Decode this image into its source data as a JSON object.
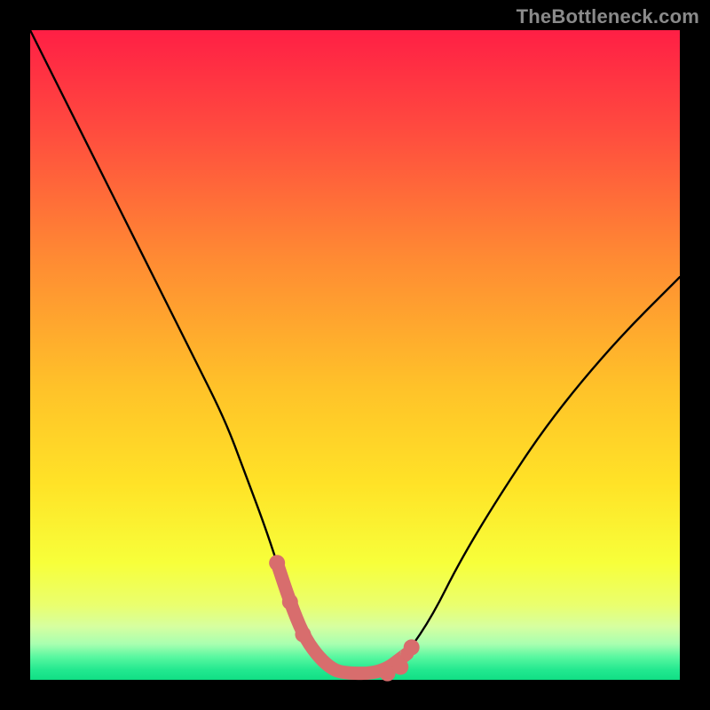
{
  "watermark": "TheBottleneck.com",
  "colors": {
    "frame": "#000000",
    "watermark": "#8a8a8a",
    "curve_stroke": "#000000",
    "highlight": "#d86d6d",
    "gradient_stops": [
      {
        "offset": 0.0,
        "color": "#ff1f45"
      },
      {
        "offset": 0.15,
        "color": "#ff4a3f"
      },
      {
        "offset": 0.35,
        "color": "#ff8a33"
      },
      {
        "offset": 0.55,
        "color": "#ffc229"
      },
      {
        "offset": 0.7,
        "color": "#ffe327"
      },
      {
        "offset": 0.82,
        "color": "#f7ff3a"
      },
      {
        "offset": 0.885,
        "color": "#eaff6e"
      },
      {
        "offset": 0.918,
        "color": "#d6ffa0"
      },
      {
        "offset": 0.945,
        "color": "#a8ffb0"
      },
      {
        "offset": 0.965,
        "color": "#58f7a0"
      },
      {
        "offset": 0.985,
        "color": "#22e88f"
      },
      {
        "offset": 1.0,
        "color": "#11df85"
      }
    ]
  },
  "chart_data": {
    "type": "line",
    "title": "",
    "xlabel": "",
    "ylabel": "",
    "xlim": [
      0,
      100
    ],
    "ylim": [
      0,
      100
    ],
    "series": [
      {
        "name": "bottleneck-curve",
        "x": [
          0,
          5,
          10,
          15,
          20,
          25,
          30,
          33,
          36,
          38,
          40,
          42,
          44,
          46,
          48,
          54,
          58,
          62,
          66,
          72,
          80,
          90,
          100
        ],
        "values": [
          100,
          90,
          80,
          70,
          60,
          50,
          40,
          32,
          24,
          18,
          12,
          7,
          4,
          2,
          1,
          1,
          4,
          10,
          18,
          28,
          40,
          52,
          62
        ]
      }
    ],
    "highlight": {
      "name": "optimal-zone",
      "x": [
        38,
        40,
        42,
        44,
        46,
        48,
        54,
        58
      ],
      "values": [
        18,
        12,
        7,
        4,
        2,
        1,
        1,
        4
      ],
      "dot_x": [
        38,
        40,
        42,
        55,
        57,
        58.7
      ],
      "dot_values": [
        18,
        12,
        7,
        1,
        2,
        5
      ]
    }
  }
}
